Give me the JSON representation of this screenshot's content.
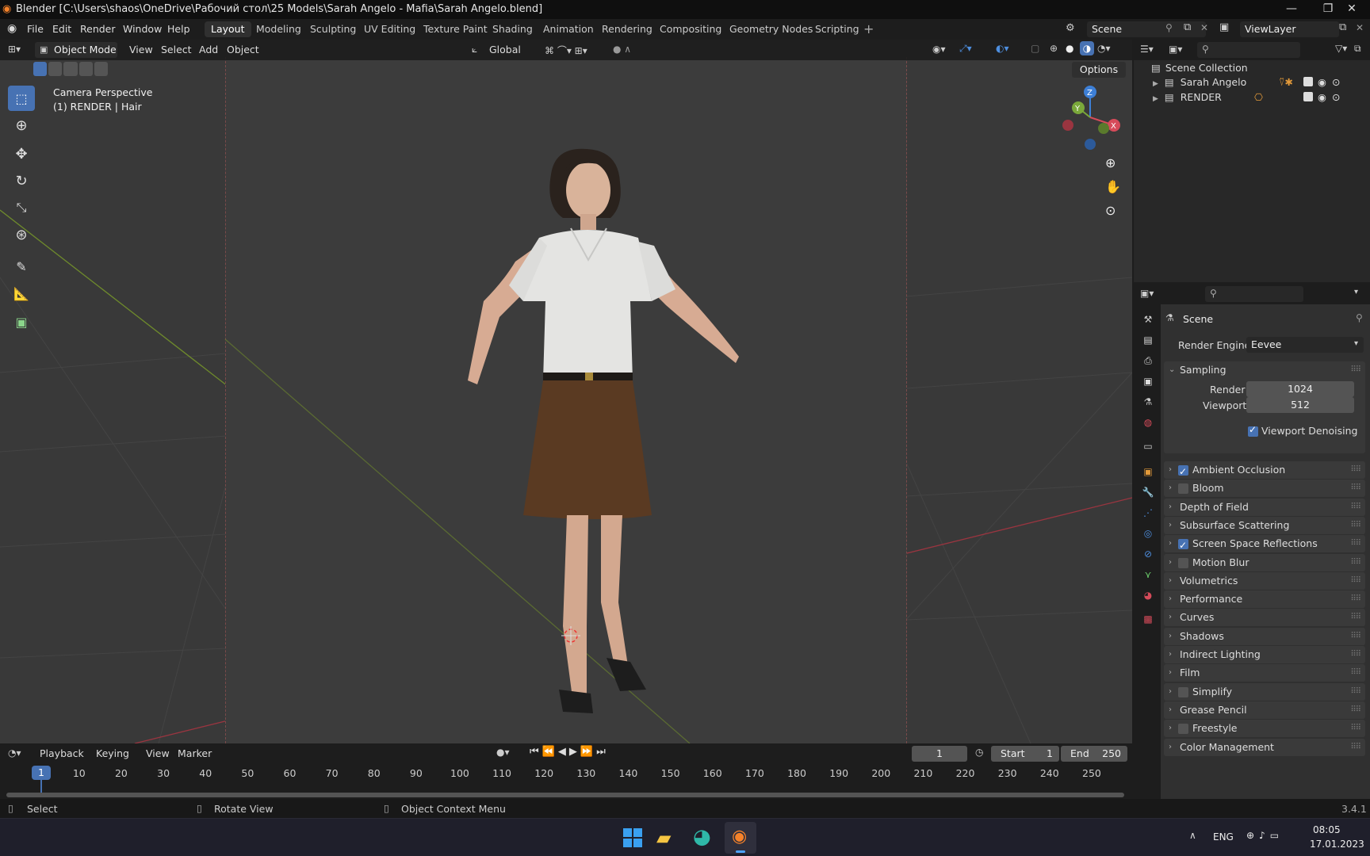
{
  "window": {
    "title": "Blender [C:\\Users\\shaos\\OneDrive\\Рабочий стол\\25 Models\\Sarah Angelo - Mafia\\Sarah Angelo.blend]",
    "minimize": "—",
    "maximize": "❐",
    "close": "✕"
  },
  "menu": [
    "File",
    "Edit",
    "Render",
    "Window",
    "Help"
  ],
  "workspaces": [
    "Layout",
    "Modeling",
    "Sculpting",
    "UV Editing",
    "Texture Paint",
    "Shading",
    "Animation",
    "Rendering",
    "Compositing",
    "Geometry Nodes",
    "Scripting"
  ],
  "active_workspace": "Layout",
  "add_workspace": "+",
  "scene_field": "Scene",
  "viewlayer_field": "ViewLayer",
  "viewport": {
    "mode": "Object Mode",
    "menus": [
      "View",
      "Select",
      "Add",
      "Object"
    ],
    "orientation": "Global",
    "options": "Options",
    "overlay_line1": "Camera Perspective",
    "overlay_line2": "(1) RENDER | Hair",
    "gizmo": {
      "z": "Z",
      "y": "Y",
      "x": "X"
    }
  },
  "outliner": {
    "root": "Scene Collection",
    "items": [
      {
        "label": "Sarah Angelo"
      },
      {
        "label": "RENDER"
      }
    ]
  },
  "properties": {
    "header": "Scene",
    "render_engine_label": "Render Engine",
    "render_engine_value": "Eevee",
    "sampling": {
      "label": "Sampling",
      "render_label": "Render",
      "render_value": "1024",
      "viewport_label": "Viewport",
      "viewport_value": "512",
      "denoise_label": "Viewport Denoising",
      "denoise_checked": true
    },
    "sections": [
      {
        "label": "Ambient Occlusion",
        "checkbox": true,
        "checked": true
      },
      {
        "label": "Bloom",
        "checkbox": true,
        "checked": false
      },
      {
        "label": "Depth of Field",
        "checkbox": false
      },
      {
        "label": "Subsurface Scattering",
        "checkbox": false
      },
      {
        "label": "Screen Space Reflections",
        "checkbox": true,
        "checked": true
      },
      {
        "label": "Motion Blur",
        "checkbox": true,
        "checked": false
      },
      {
        "label": "Volumetrics",
        "checkbox": false
      },
      {
        "label": "Performance",
        "checkbox": false
      },
      {
        "label": "Curves",
        "checkbox": false
      },
      {
        "label": "Shadows",
        "checkbox": false
      },
      {
        "label": "Indirect Lighting",
        "checkbox": false
      },
      {
        "label": "Film",
        "checkbox": false
      },
      {
        "label": "Simplify",
        "checkbox": true,
        "checked": false
      },
      {
        "label": "Grease Pencil",
        "checkbox": false
      },
      {
        "label": "Freestyle",
        "checkbox": true,
        "checked": false
      },
      {
        "label": "Color Management",
        "checkbox": false
      }
    ]
  },
  "timeline": {
    "menus": [
      "Playback",
      "Keying",
      "View",
      "Marker"
    ],
    "current_frame": "1",
    "start_label": "Start",
    "start_value": "1",
    "end_label": "End",
    "end_value": "250",
    "ticks": [
      "1",
      "10",
      "20",
      "30",
      "40",
      "50",
      "60",
      "70",
      "80",
      "90",
      "100",
      "110",
      "120",
      "130",
      "140",
      "150",
      "160",
      "170",
      "180",
      "190",
      "200",
      "210",
      "220",
      "230",
      "240",
      "250"
    ]
  },
  "status": {
    "select": "Select",
    "rotate": "Rotate View",
    "context": "Object Context Menu",
    "version": "3.4.1"
  },
  "taskbar": {
    "lang": "ENG",
    "time": "08:05",
    "date": "17.01.2023"
  },
  "colors": {
    "accent": "#4772b3",
    "x_axis": "#d64b5a",
    "y_axis": "#7aa83a",
    "z_axis": "#3d7fd6"
  }
}
